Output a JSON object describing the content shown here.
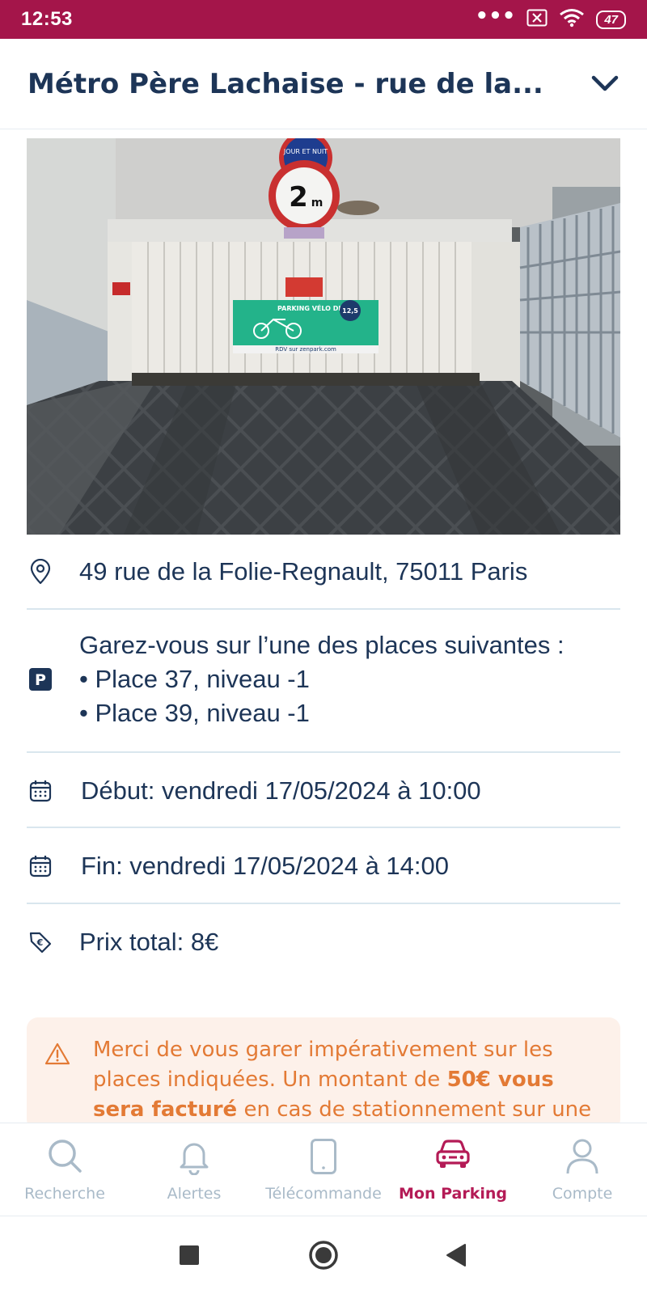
{
  "status_bar": {
    "time": "12:53",
    "dots": "•••",
    "battery": "47",
    "background_color": "#a4154a"
  },
  "header": {
    "title": "Métro Père Lachaise - rue de la..."
  },
  "photo": {
    "sign_top_text": "JOUR ET NUIT",
    "height_limit": "2",
    "height_unit": "m",
    "poster_text": "PARKING VÉLO DISPO",
    "poster_badge": "12,5",
    "poster_footer": "RDV sur zenpark.com",
    "carousel": {
      "count": 4,
      "active_index": 0
    }
  },
  "details": {
    "address": "49 rue de la Folie-Regnault, 75011 Paris",
    "places_intro": "Garez-vous sur l’une des places suivantes :",
    "places": [
      "• Place 37, niveau -1",
      "• Place 39, niveau -1"
    ],
    "start": "Début: vendredi 17/05/2024 à 10:00",
    "end": "Fin: vendredi 17/05/2024 à 14:00",
    "price": "Prix total: 8€"
  },
  "warning": {
    "text_before": "Merci de vous garer impérativement sur les places indiquées. Un montant de ",
    "bold": "50€ vous sera facturé",
    "text_after": " en cas de stationnement sur une autre",
    "color": "#e37a35"
  },
  "bottom_nav": {
    "items": [
      {
        "label": "Recherche",
        "icon": "search-icon"
      },
      {
        "label": "Alertes",
        "icon": "bell-icon"
      },
      {
        "label": "Télécommande",
        "icon": "phone-icon"
      },
      {
        "label": "Mon Parking",
        "icon": "car-icon",
        "active": true
      },
      {
        "label": "Compte",
        "icon": "user-icon"
      }
    ],
    "active_color": "#b41b56",
    "inactive_color": "#a9bac8"
  },
  "colors": {
    "primary_text": "#1d3557",
    "divider": "#d9e6ee"
  }
}
